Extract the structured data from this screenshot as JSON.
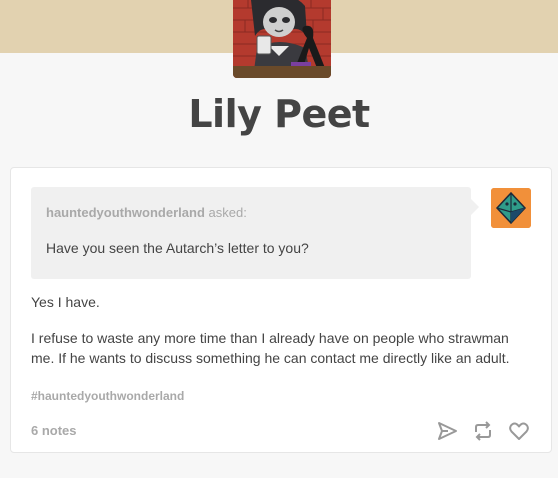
{
  "blog": {
    "title": "Lily Peet"
  },
  "post": {
    "ask": {
      "asker": "hauntedyouthwonderland",
      "verb": "asked:",
      "question": "Have you seen the Autarch’s letter to you?"
    },
    "answer": [
      "Yes I have.",
      "I refuse to waste any more time than I already have on people who strawman me. If he wants to discuss something he can contact me directly like an adult."
    ],
    "tags": [
      "#hauntedyouthwonderland"
    ],
    "notes": "6 notes",
    "actions": [
      "send-icon",
      "reblog-icon",
      "like-icon"
    ]
  },
  "colors": {
    "header_band": "#e2d2b0",
    "asker_avatar": "#f1903a",
    "muted_text": "#a9a9a9",
    "body_text": "#444444"
  }
}
